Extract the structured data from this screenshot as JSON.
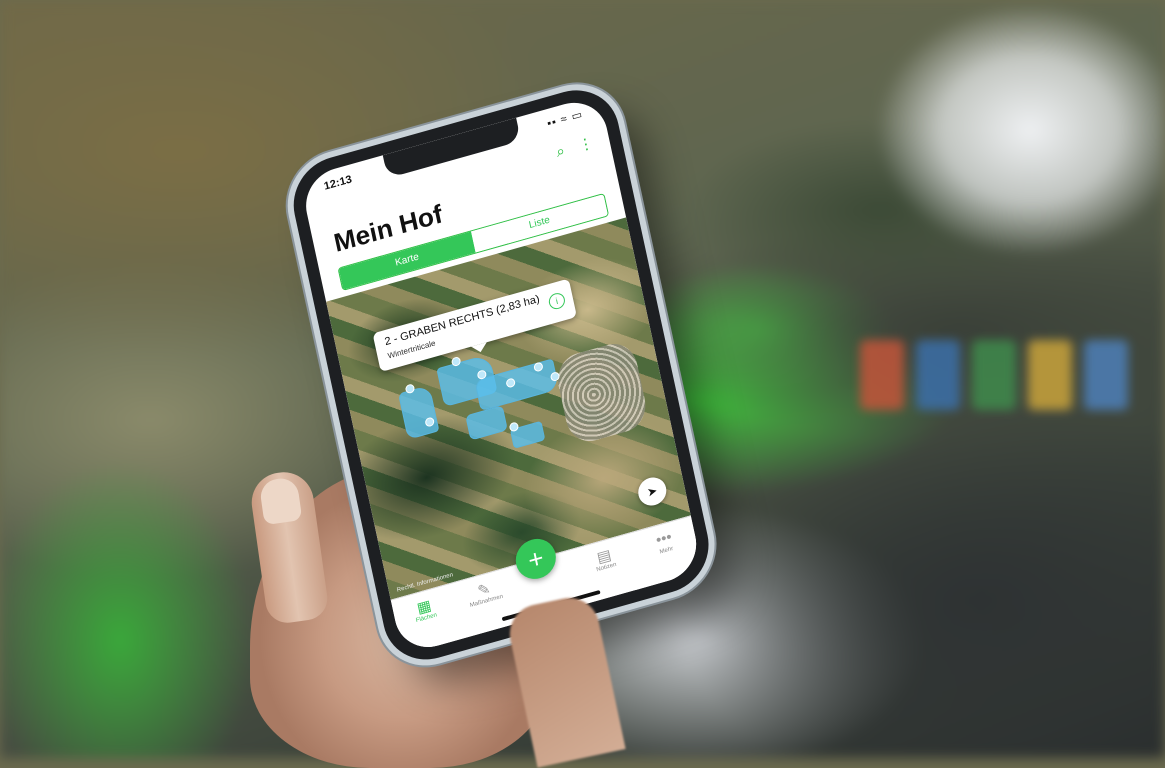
{
  "status_bar": {
    "time": "12:13",
    "icons": "▪▪ ≈ ▭"
  },
  "header": {
    "title": "Mein Hof",
    "search_icon": "search-icon",
    "more_icon": "more-vertical-icon"
  },
  "view_toggle": {
    "options": [
      "Karte",
      "Liste"
    ],
    "selected": "Karte"
  },
  "map": {
    "callout": {
      "title": "2 - GRABEN RECHTS (2,83 ha)",
      "subtitle": "Wintertriticale"
    },
    "attribution": "Rechtl. Informationen",
    "locate_icon": "navigation-arrow-icon",
    "field_color": "#5abee8"
  },
  "fab": {
    "label": "+"
  },
  "tabbar": {
    "items": [
      {
        "label": "Flächen",
        "icon": "fields-icon",
        "active": true
      },
      {
        "label": "Maßnahmen",
        "icon": "pencil-icon",
        "active": false
      },
      {
        "label": "",
        "icon": "spacer",
        "active": false
      },
      {
        "label": "Notizen",
        "icon": "notes-icon",
        "active": false
      },
      {
        "label": "Mehr",
        "icon": "more-icon",
        "active": false
      }
    ]
  },
  "colors": {
    "accent": "#34c759"
  }
}
